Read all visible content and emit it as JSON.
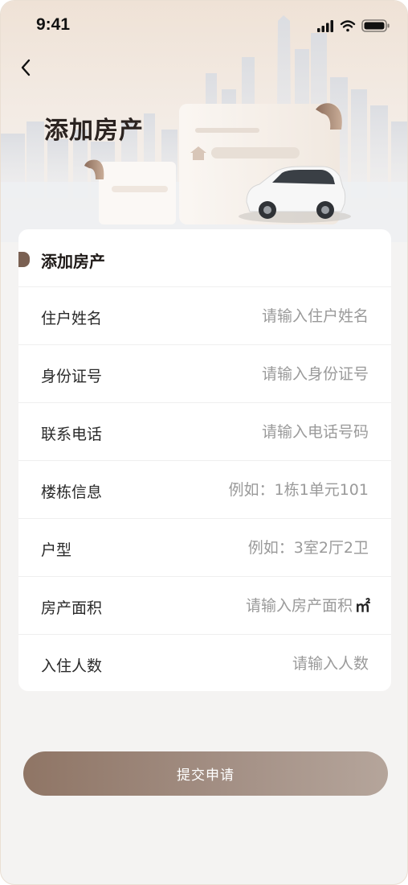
{
  "status_bar": {
    "time": "9:41"
  },
  "header": {
    "title": "添加房产"
  },
  "form": {
    "section_title": "添加房产",
    "fields": [
      {
        "label": "住户姓名",
        "placeholder": "请输入住户姓名",
        "value": ""
      },
      {
        "label": "身份证号",
        "placeholder": "请输入身份证号",
        "value": ""
      },
      {
        "label": "联系电话",
        "placeholder": "请输入电话号码",
        "value": ""
      },
      {
        "label": "楼栋信息",
        "placeholder": "例如：1栋1单元101",
        "value": ""
      },
      {
        "label": "户型",
        "placeholder": "例如：3室2厅2卫",
        "value": ""
      },
      {
        "label": "房产面积",
        "placeholder": "请输入房产面积",
        "value": "",
        "unit": "㎡"
      },
      {
        "label": "入住人数",
        "placeholder": "请输入人数",
        "value": ""
      }
    ]
  },
  "actions": {
    "submit_label": "提交申请"
  },
  "icons": {
    "back": "chevron-left-icon",
    "signal": "signal-icon",
    "wifi": "wifi-icon",
    "battery": "battery-icon"
  },
  "colors": {
    "accent": "#8f7565",
    "accent_light": "#b5a59b",
    "marker": "#7a6052",
    "background": "#f4f3f2"
  }
}
